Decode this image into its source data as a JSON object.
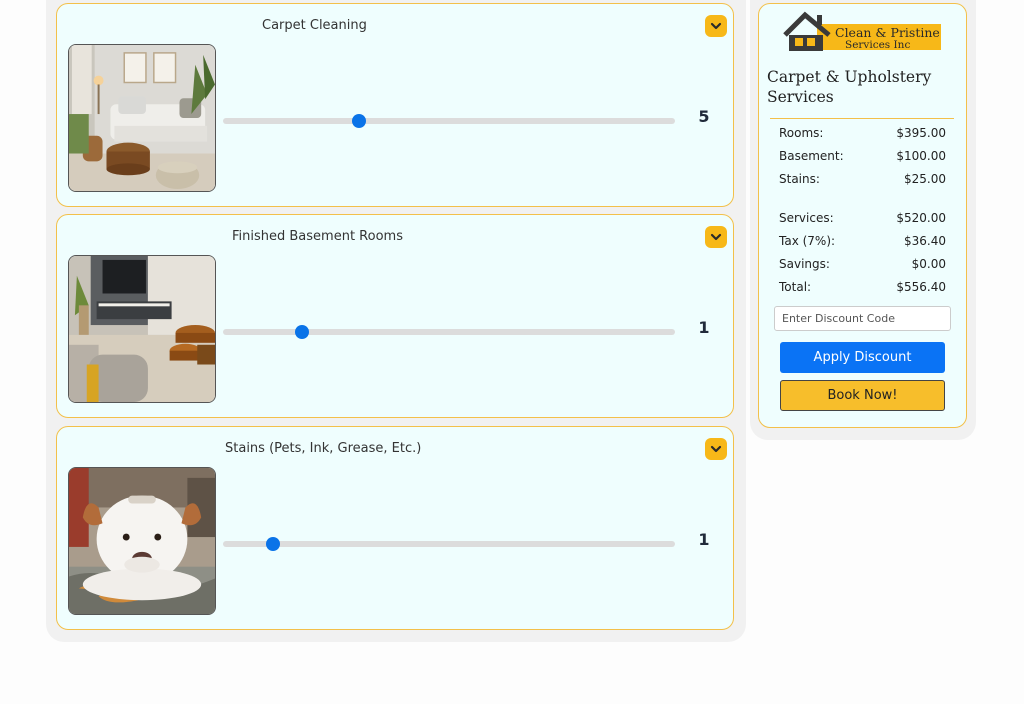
{
  "services": [
    {
      "title": "Carpet Cleaning",
      "quantity": "5",
      "slider_fraction": 0.3,
      "image": "living-room-photo"
    },
    {
      "title": "Finished Basement Rooms",
      "quantity": "1",
      "slider_fraction": 0.175,
      "image": "basement-room-photo"
    },
    {
      "title": "Stains (Pets, Ink, Grease, Etc.)",
      "quantity": "1",
      "slider_fraction": 0.11,
      "image": "dog-photo"
    }
  ],
  "summary": {
    "logo_line1": "Clean & Pristine",
    "logo_line2": "Services Inc",
    "title": "Carpet & Upholstery Services",
    "line_items": [
      {
        "label": "Rooms:",
        "value": "$395.00"
      },
      {
        "label": "Basement:",
        "value": "$100.00"
      },
      {
        "label": "Stains:",
        "value": "$25.00"
      }
    ],
    "totals": [
      {
        "label": "Services:",
        "value": "$520.00"
      },
      {
        "label": "Tax (7%):",
        "value": "$36.40"
      },
      {
        "label": "Savings:",
        "value": "$0.00"
      },
      {
        "label": "Total:",
        "value": "$556.40"
      }
    ],
    "discount_placeholder": "Enter Discount Code",
    "apply_label": "Apply Discount",
    "book_label": "Book Now!"
  },
  "colors": {
    "accent_yellow": "#f7b818",
    "card_border": "#f3c04a",
    "card_background": "#effefe",
    "slider_blue": "#0a73e8",
    "button_blue": "#0a73f5"
  },
  "icons": [
    "chevron-down-icon",
    "house-logo-icon"
  ]
}
